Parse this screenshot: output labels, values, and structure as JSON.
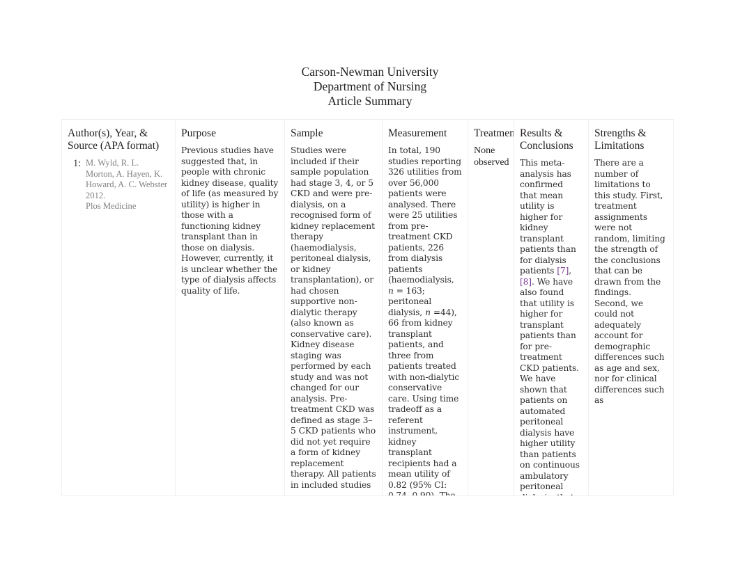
{
  "document": {
    "institution": "Carson-Newman University",
    "department": "Department of Nursing",
    "doc_type": "Article Summary"
  },
  "table": {
    "columns": [
      {
        "key": "author",
        "header": "Author(s), Year, & Source (APA format)"
      },
      {
        "key": "purpose",
        "header": "Purpose"
      },
      {
        "key": "sample",
        "header": "Sample"
      },
      {
        "key": "measurement",
        "header": "Measurement"
      },
      {
        "key": "treatment",
        "header": "Treatment"
      },
      {
        "key": "results",
        "header": "Results & Conclusions"
      },
      {
        "key": "strengths",
        "header": "Strengths & Limitations"
      }
    ],
    "row": {
      "author": {
        "number": "1:",
        "names": "M. Wyld, R. L. Morton, A. Hayen, K. Howard, A. C. Webster",
        "year": "2012.",
        "source": "Plos Medicine"
      },
      "purpose": "Previous studies have suggested that, in people with chronic kidney disease, quality of life (as measured by utility) is higher in those with a functioning kidney transplant than in those on dialysis. However, currently, it is unclear whether the type of dialysis affects quality of life.",
      "sample": "Studies were included if their sample population had stage 3, 4, or 5 CKD and were pre-dialysis, on a recognised form of kidney replacement therapy (haemodialysis, peritoneal dialysis, or kidney transplantation), or had chosen supportive non-dialytic therapy (also known as conservative care). Kidney disease staging was performed by each study and was not changed for our analysis. Pre-treatment CKD was defined as stage 3–5 CKD patients who did not yet require a form of kidney replacement therapy. All patients in included studies",
      "measurement_part1": "In total, 190 studies reporting 326 utilities from over 56,000 patients were analysed. There were 25 utilities from pre-treatment CKD patients, 226 from dialysis patients (haemodialysis, ",
      "measurement_n1": "n",
      "measurement_part2": " = 163; peritoneal dialysis, ",
      "measurement_n2": "n",
      "measurement_part3": " =44), 66 from kidney transplant patients, and three from patients treated with non-dialytic conservative care. Using time tradeoff as a referent instrument, kidney transplant recipients had a mean utility of 0.82 (95% CI: 0.74, 0.90). The mean utility was comparable in",
      "treatment": "None observed",
      "results_part1": "This meta-analysis has confirmed that mean utility is higher for kidney transplant patients than for dialysis patients  ",
      "results_cite1": "[7]",
      "results_cite_sep": ",",
      "results_cite2": "[8]",
      "results_part2": ". We have also found that utility is higher for transplant patients than for pre-treatment CKD patients. We have shown that patients on automated peritoneal dialysis have higher utility than patients on continuous ambulatory peritoneal dialysis, that diabetes has an adverse influence on utility for pre-treatment CKD",
      "strengths": "There are a number of limitations to this study. First, treatment assignments were not random, limiting the strength of the conclusions that can be drawn from the findings. Second, we could not adequately account for demographic differences such as age and sex, nor for clinical differences such as"
    }
  },
  "colors": {
    "text": "#231f20",
    "body_text": "#2b2b2b",
    "muted_text": "#808080",
    "link": "#7b3b91",
    "border": "#f0f0f0"
  }
}
